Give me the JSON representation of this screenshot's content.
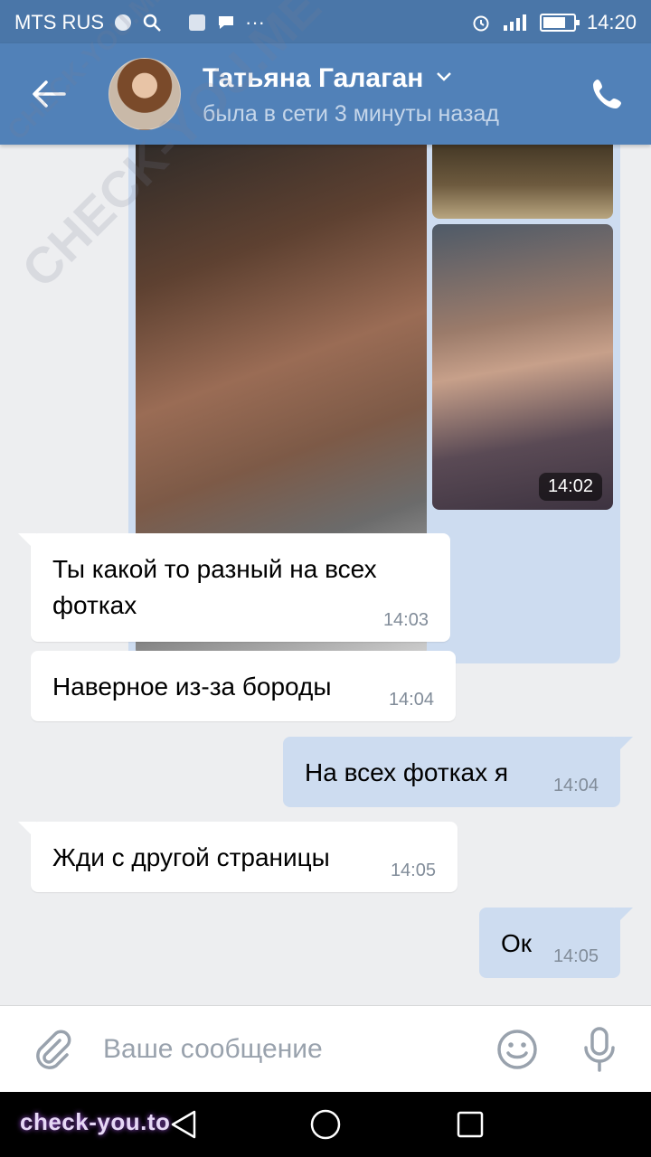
{
  "status_bar": {
    "carrier": "MTS RUS",
    "time": "14:20"
  },
  "header": {
    "contact_name": "Татьяна Галаган",
    "last_seen": "была в сети 3 минуты назад"
  },
  "messages": [
    {
      "direction": "out",
      "type": "photos",
      "time": "14:02"
    },
    {
      "direction": "in",
      "text_lines": [
        "Ты какой то разный на всех",
        "фотках"
      ],
      "time": "14:03"
    },
    {
      "direction": "in",
      "text": "Наверное из-за бороды",
      "time": "14:04"
    },
    {
      "direction": "out",
      "text": "На всех фотках я",
      "time": "14:04"
    },
    {
      "direction": "in",
      "text": "Жди с другой страницы",
      "time": "14:05"
    },
    {
      "direction": "out",
      "text": "Ок",
      "time": "14:05"
    }
  ],
  "composer": {
    "placeholder": "Ваше сообщение"
  },
  "watermarks": {
    "overlay": "CHECK-YOU.ME",
    "url": "check-you.to"
  },
  "colors": {
    "header": "#5181b8",
    "status_bar": "#4a76a8",
    "outgoing_bubble": "#cddcf0",
    "incoming_bubble": "#ffffff",
    "background": "#edeef0"
  },
  "icons": [
    "back-arrow-icon",
    "chevron-down-icon",
    "phone-icon",
    "paperclip-icon",
    "emoji-icon",
    "microphone-icon"
  ]
}
